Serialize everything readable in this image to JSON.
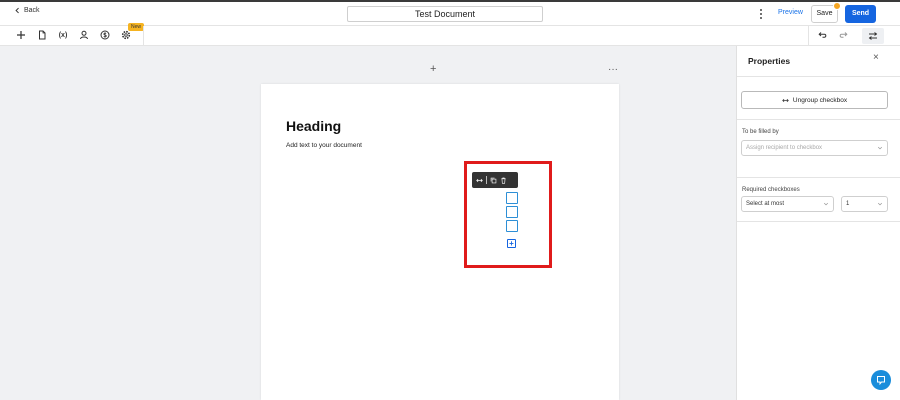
{
  "header": {
    "back_label": "Back",
    "document_title": "Test Document",
    "preview_label": "Preview",
    "save_label": "Save",
    "send_label": "Send"
  },
  "toolbar": {
    "variables_label": "(x)",
    "new_badge": "New",
    "icons": [
      "plus-icon",
      "document-icon",
      "variables-icon",
      "user-icon",
      "dollar-icon",
      "gear-icon",
      "undo-icon",
      "redo-icon",
      "settings-sliders-icon"
    ]
  },
  "canvas": {
    "add_label": "+",
    "more_label": "···"
  },
  "document": {
    "heading": "Heading",
    "body": "Add text to your document"
  },
  "checkbox_group": {
    "count": 3,
    "add_label": "+"
  },
  "properties": {
    "title": "Properties",
    "close_label": "×",
    "ungroup_label": "Ungroup checkbox",
    "filled_by_label": "To be filled by",
    "assign_placeholder": "Assign recipient to checkbox",
    "required_label": "Required checkboxes",
    "rule_value": "Select at most",
    "count_value": "1"
  },
  "colors": {
    "accent": "#1565e0",
    "selection": "#e01b1b",
    "checkbox": "#2d8fd6",
    "badge": "#f5b321"
  }
}
